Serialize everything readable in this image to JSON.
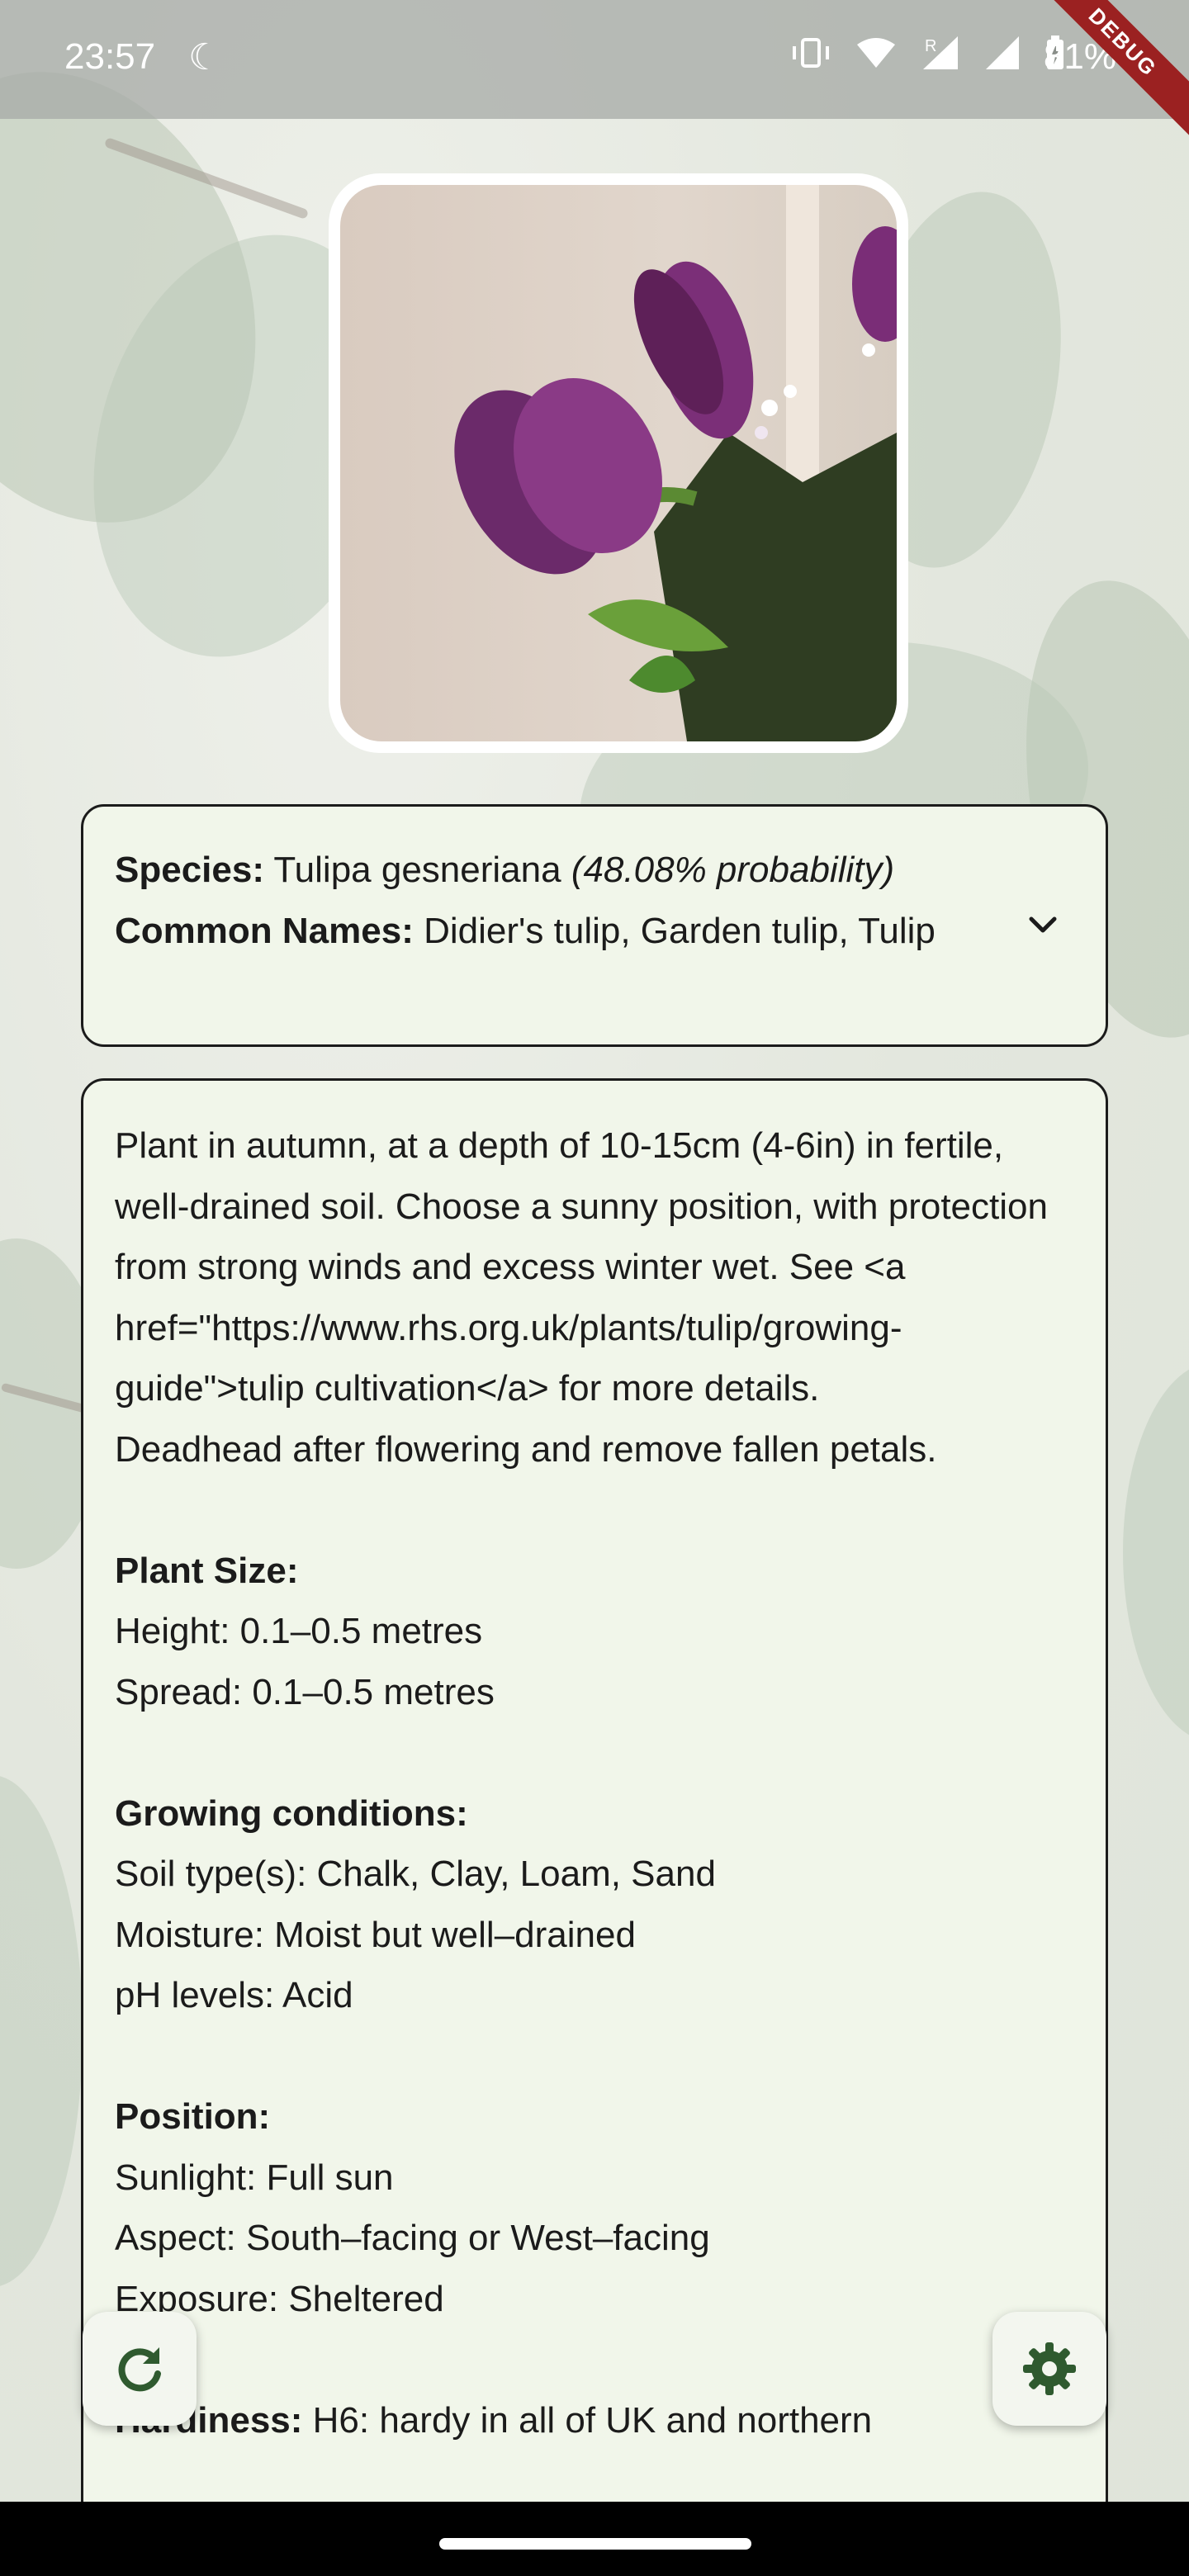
{
  "status_bar": {
    "time": "23:57",
    "battery_percent": "81%",
    "debug_label": "DEBUG",
    "icons": [
      "moon-icon",
      "vibrate-icon",
      "wifi-icon",
      "signal-roaming-icon",
      "signal-icon",
      "battery-charging-icon"
    ]
  },
  "species_card": {
    "species_label": "Species:",
    "species_name": "Tulipa gesneriana",
    "probability": "(48.08% probability)",
    "common_names_label": "Common Names:",
    "common_names": "Didier's tulip, Garden tulip, Tulip"
  },
  "info_card": {
    "intro": "Plant in autumn, at a depth of 10-15cm (4-6in) in fertile, well-drained soil. Choose a sunny position, with protection from strong winds and excess winter wet. See <a href=\"https://www.rhs.org.uk/plants/tulip/growing-guide\">tulip cultivation</a> for more details.",
    "deadhead": "Deadhead after flowering and remove fallen petals.",
    "plant_size_heading": "Plant Size:",
    "height": "Height: 0.1–0.5 metres",
    "spread": "Spread: 0.1–0.5 metres",
    "growing_heading": "Growing conditions:",
    "soil": "Soil type(s): Chalk, Clay, Loam, Sand",
    "moisture": "Moisture: Moist but well–drained",
    "ph": "pH levels: Acid",
    "position_heading": "Position:",
    "sunlight": "Sunlight: Full sun",
    "aspect": "Aspect: South–facing or West–facing",
    "exposure": "Exposure: Sheltered",
    "hardiness_label": "Hardiness:",
    "hardiness_value": "H6: hardy in all of UK and northern"
  },
  "colors": {
    "card_bg": "#f1f6ea",
    "fab_icon": "#2f5a2f"
  }
}
